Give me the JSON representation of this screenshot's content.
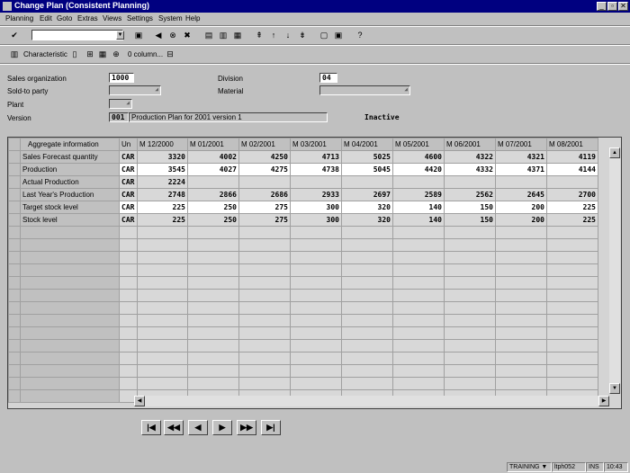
{
  "window": {
    "title": "Change Plan (Consistent Planning)"
  },
  "window_controls": {
    "minimize": "_",
    "maximize": "▫",
    "close": "✕"
  },
  "menu": [
    "Planning",
    "Edit",
    "Goto",
    "Extras",
    "Views",
    "Settings",
    "System",
    "Help"
  ],
  "app_toolbar": {
    "characteristic_label": "Characteristic",
    "columns_label": "0 column..."
  },
  "header": {
    "sales_org": {
      "label": "Sales organization",
      "value": "1000"
    },
    "division": {
      "label": "Division",
      "value": "04"
    },
    "sold_to": {
      "label": "Sold-to party",
      "value": ""
    },
    "material": {
      "label": "Material",
      "value": ""
    },
    "plant": {
      "label": "Plant",
      "value": ""
    },
    "version": {
      "label": "Version",
      "value": "001",
      "description": "Production Plan for 2001 version 1"
    },
    "status": "Inactive"
  },
  "grid": {
    "columns": [
      "Aggregate information",
      "Un",
      "M 12/2000",
      "M 01/2001",
      "M 02/2001",
      "M 03/2001",
      "M 04/2001",
      "M 05/2001",
      "M 06/2001",
      "M 07/2001",
      "M 08/2001"
    ],
    "rows": [
      {
        "label": "Sales Forecast quantity",
        "unit": "CAR",
        "values": [
          "3320",
          "4002",
          "4250",
          "4713",
          "5025",
          "4600",
          "4322",
          "4321",
          "4119"
        ]
      },
      {
        "label": "Production",
        "unit": "CAR",
        "values": [
          "3545",
          "4027",
          "4275",
          "4738",
          "5045",
          "4420",
          "4332",
          "4371",
          "4144"
        ]
      },
      {
        "label": "Actual Production",
        "unit": "CAR",
        "values": [
          "2224",
          "",
          "",
          "",
          "",
          "",
          "",
          "",
          ""
        ]
      },
      {
        "label": "Last Year's Production",
        "unit": "CAR",
        "values": [
          "2748",
          "2866",
          "2686",
          "2933",
          "2697",
          "2589",
          "2562",
          "2645",
          "2700"
        ]
      },
      {
        "label": "Target stock level",
        "unit": "CAR",
        "values": [
          "225",
          "250",
          "275",
          "300",
          "320",
          "140",
          "150",
          "200",
          "225"
        ]
      },
      {
        "label": "Stock level",
        "unit": "CAR",
        "values": [
          "225",
          "250",
          "275",
          "300",
          "320",
          "140",
          "150",
          "200",
          "225"
        ]
      }
    ],
    "empty_rows": 14
  },
  "nav_buttons": [
    "|◀",
    "◀◀",
    "◀",
    "▶",
    "▶▶",
    "▶|"
  ],
  "statusbar": {
    "system": "TRAINING",
    "server": "ltph052",
    "mode": "INS",
    "time": "10:43"
  },
  "colors": {
    "titlebar": "#000080",
    "window": "#c0c0c0",
    "grid_editable": "#ffffff"
  }
}
